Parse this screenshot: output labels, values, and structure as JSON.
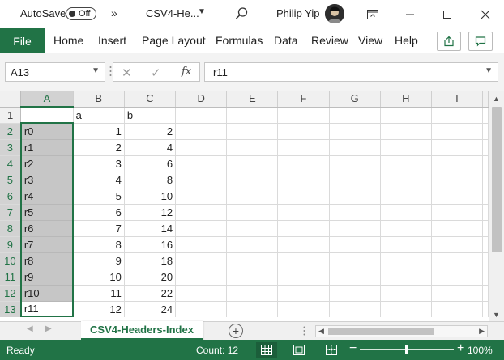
{
  "titlebar": {
    "autosave_label": "AutoSave",
    "autosave_state": "Off",
    "more_label": "»",
    "doc_title": "CSV4-He...",
    "user_name": "Philip Yip"
  },
  "ribbon": {
    "file": "File",
    "tabs": [
      "Home",
      "Insert",
      "Page Layout",
      "Formulas",
      "Data",
      "Review",
      "View",
      "Help"
    ]
  },
  "formula_bar": {
    "name_box": "A13",
    "fx_label": "fx",
    "formula": "r11"
  },
  "grid": {
    "columns": [
      "A",
      "B",
      "C",
      "D",
      "E",
      "F",
      "G",
      "H",
      "I"
    ],
    "rows": [
      {
        "n": "1",
        "A": "",
        "B": "a",
        "C": "b"
      },
      {
        "n": "2",
        "A": "r0",
        "B": "1",
        "C": "2"
      },
      {
        "n": "3",
        "A": "r1",
        "B": "2",
        "C": "4"
      },
      {
        "n": "4",
        "A": "r2",
        "B": "3",
        "C": "6"
      },
      {
        "n": "5",
        "A": "r3",
        "B": "4",
        "C": "8"
      },
      {
        "n": "6",
        "A": "r4",
        "B": "5",
        "C": "10"
      },
      {
        "n": "7",
        "A": "r5",
        "B": "6",
        "C": "12"
      },
      {
        "n": "8",
        "A": "r6",
        "B": "7",
        "C": "14"
      },
      {
        "n": "9",
        "A": "r7",
        "B": "8",
        "C": "16"
      },
      {
        "n": "10",
        "A": "r8",
        "B": "9",
        "C": "18"
      },
      {
        "n": "11",
        "A": "r9",
        "B": "10",
        "C": "20"
      },
      {
        "n": "12",
        "A": "r10",
        "B": "11",
        "C": "22"
      },
      {
        "n": "13",
        "A": "r11",
        "B": "12",
        "C": "24"
      }
    ]
  },
  "sheet_tabs": {
    "active": "CSV4-Headers-Index",
    "add_label": "+"
  },
  "statusbar": {
    "ready": "Ready",
    "count": "Count: 12",
    "zoom_minus": "−",
    "zoom_plus": "+",
    "zoom": "100%",
    "zoom_fraction": 0.5
  },
  "colors": {
    "accent": "#217346",
    "selection_fill": "#c6c6c6"
  }
}
